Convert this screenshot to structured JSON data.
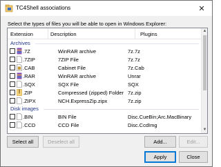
{
  "window": {
    "title": "TC4Shell associations"
  },
  "instructions": "Select the types of files you will be able to open in Windows Explorer:",
  "columns": {
    "extension": "Extension",
    "description": "Description",
    "plugins": "Plugins"
  },
  "groups": [
    {
      "label": "Archives",
      "rows": [
        {
          "ext": ".7Z",
          "desc": "WinRAR archive",
          "plugin": "7z.7z",
          "icon": "winrar-icon"
        },
        {
          "ext": ".7ZIP",
          "desc": "7ZIP File",
          "plugin": "7z.7z",
          "icon": "blank-file-icon"
        },
        {
          "ext": ".CAB",
          "desc": "Cabinet File",
          "plugin": "7z.Cab",
          "icon": "cabinet-icon"
        },
        {
          "ext": ".RAR",
          "desc": "WinRAR archive",
          "plugin": "Unrar",
          "icon": "winrar-icon"
        },
        {
          "ext": ".SQX",
          "desc": "SQX File",
          "plugin": "SQX",
          "icon": "blank-file-icon"
        },
        {
          "ext": ".ZIP",
          "desc": "Compressed (zipped) Folder",
          "plugin": "7z.zip",
          "icon": "zip-folder-icon"
        },
        {
          "ext": ".ZIPX",
          "desc": "NCH.ExpressZip.zipx",
          "plugin": "7z.zip",
          "icon": "blank-file-icon"
        }
      ]
    },
    {
      "label": "Disk images",
      "rows": [
        {
          "ext": ".BIN",
          "desc": "BIN File",
          "plugin": "Disc.CueBin;Arc.MacBinary",
          "icon": "blank-file-icon"
        },
        {
          "ext": ".CCD",
          "desc": "CCD File",
          "plugin": "Disc.CcdImg",
          "icon": "blank-file-icon"
        }
      ]
    }
  ],
  "buttons": {
    "select_all": "Select all",
    "deselect_all": "Deselect all",
    "add": "Add...",
    "edit": "Edit...",
    "apply": "Apply",
    "close": "Close"
  }
}
